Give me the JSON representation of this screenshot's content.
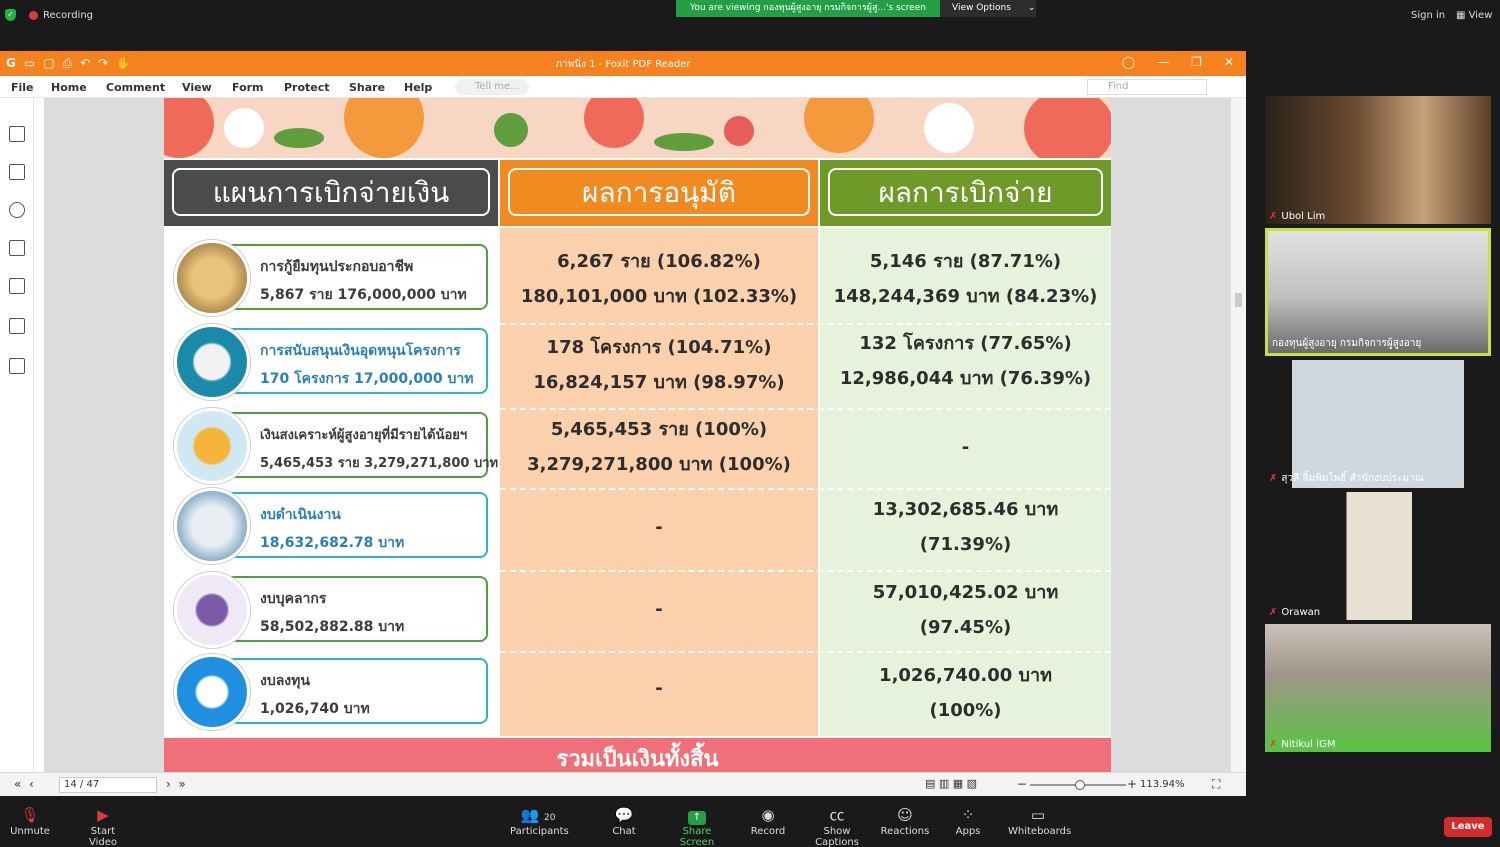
{
  "zoom": {
    "recording": "Recording",
    "viewing_banner": "You are viewing กองทุนผู้สูงอายุ กรมกิจการผู้สู...'s screen",
    "view_options": "View Options",
    "sign_in": "Sign in",
    "view": "View",
    "toolbar": {
      "unmute": "Unmute",
      "start_video": "Start Video",
      "participants": "Participants",
      "participants_count": "20",
      "chat": "Chat",
      "share_screen": "Share Screen",
      "record": "Record",
      "show_captions": "Show Captions",
      "reactions": "Reactions",
      "apps": "Apps",
      "whiteboards": "Whiteboards",
      "leave": "Leave"
    },
    "participants": [
      {
        "name": "Ubol Lim"
      },
      {
        "name": "กองทุนผู้สูงอายุ กรมกิจการผู้สูงอายุ"
      },
      {
        "name": "สุวลี ลิ้มพิมโพธิ์ สำนักงบประมาณ"
      },
      {
        "name": "Orawan"
      },
      {
        "name": "Nitikul IGM"
      }
    ]
  },
  "foxit": {
    "title": "ภาพนิ่ง 1 - Foxit PDF Reader",
    "menu": [
      "File",
      "Home",
      "Comment",
      "View",
      "Form",
      "Protect",
      "Share",
      "Help"
    ],
    "tell_me": "Tell me...",
    "find": "Find",
    "page_indicator": "14 / 47",
    "zoom_level": "113.94%"
  },
  "slide": {
    "headers": {
      "plan": "แผนการเบิกจ่ายเงิน",
      "approved": "ผลการอนุมัติ",
      "disbursed": "ผลการเบิกจ่าย"
    },
    "rows": [
      {
        "plan_l1": "การกู้ยืมทุนประกอบอาชีพ",
        "plan_l2": "5,867 ราย 176,000,000 บาท",
        "approved_l1": "6,267 ราย (106.82%)",
        "approved_l2": "180,101,000 บาท (102.33%)",
        "disbursed_l1": "5,146 ราย (87.71%)",
        "disbursed_l2": "148,244,369 บาท (84.23%)"
      },
      {
        "plan_l1": "การสนับสนุนเงินอุดหนุนโครงการ",
        "plan_l2": "170 โครงการ 17,000,000 บาท",
        "approved_l1": "178 โครงการ (104.71%)",
        "approved_l2": "16,824,157 บาท (98.97%)",
        "disbursed_l1": "132 โครงการ (77.65%)",
        "disbursed_l2": "12,986,044 บาท (76.39%)"
      },
      {
        "plan_l1": "เงินสงเคราะห์ผู้สูงอายุที่มีรายได้น้อยฯ",
        "plan_l2": "5,465,453 ราย 3,279,271,800 บาท",
        "approved_l1": "5,465,453 ราย (100%)",
        "approved_l2": "3,279,271,800 บาท (100%)",
        "disbursed_l1": "-",
        "disbursed_l2": ""
      },
      {
        "plan_l1": "งบดำเนินงาน",
        "plan_l2": "18,632,682.78 บาท",
        "approved_l1": "-",
        "approved_l2": "",
        "disbursed_l1": "13,302,685.46 บาท",
        "disbursed_l2": "(71.39%)"
      },
      {
        "plan_l1": "งบบุคลากร",
        "plan_l2": "58,502,882.88 บาท",
        "approved_l1": "-",
        "approved_l2": "",
        "disbursed_l1": "57,010,425.02 บาท",
        "disbursed_l2": "(97.45%)"
      },
      {
        "plan_l1": "งบลงทุน",
        "plan_l2": "1,026,740 บาท",
        "approved_l1": "-",
        "approved_l2": "",
        "disbursed_l1": "1,026,740.00 บาท",
        "disbursed_l2": "(100%)"
      }
    ],
    "total": "รวมเป็นเงินทั้งสิ้น"
  },
  "colors": {
    "foxit_orange": "#f5821f",
    "header_dark": "#4b4b4b",
    "header_orange": "#f28a22",
    "header_green": "#6f9a2a",
    "col_orange": "#fbd1ad",
    "col_green": "#e7f2dc",
    "total_pink": "#f0707a",
    "zoom_green": "#23a045",
    "leave_red": "#d52b2b"
  }
}
